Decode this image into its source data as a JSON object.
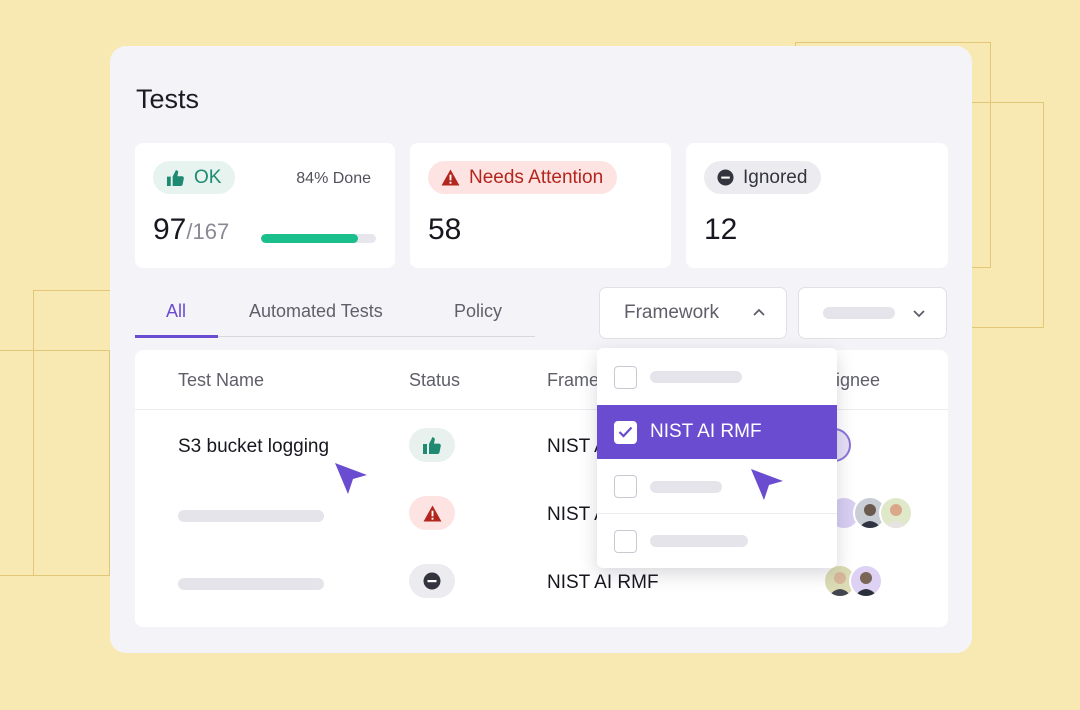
{
  "page": {
    "title": "Tests"
  },
  "stats": [
    {
      "pill_label": "OK",
      "icon": "thumbs-up-icon",
      "value": "97",
      "total": "/167",
      "done_label": "84% Done",
      "progress": 0.84,
      "color": "#1f8a72"
    },
    {
      "pill_label": "Needs Attention",
      "icon": "warning-triangle-icon",
      "value": "58",
      "color": "#b3261e"
    },
    {
      "pill_label": "Ignored",
      "icon": "minus-circle-icon",
      "value": "12",
      "color": "#34343f"
    }
  ],
  "tabs": [
    {
      "label": "All",
      "active": true
    },
    {
      "label": "Automated Tests",
      "active": false
    },
    {
      "label": "Policy",
      "active": false
    }
  ],
  "filters": {
    "framework_label": "Framework",
    "framework_icon": "chevron-up-icon",
    "second_icon": "chevron-down-icon"
  },
  "table": {
    "columns": [
      "Test Name",
      "Status",
      "Frame",
      "signee"
    ],
    "rows": [
      {
        "name": "S3 bucket logging",
        "status": "ok",
        "framework": "NIST A"
      },
      {
        "name": "",
        "status": "needs-attention",
        "framework": "NIST A"
      },
      {
        "name": "",
        "status": "ignored",
        "framework": "NIST AI RMF"
      }
    ]
  },
  "dropdown": {
    "items": [
      {
        "label": "",
        "checked": false
      },
      {
        "label": "NIST AI RMF",
        "checked": true
      },
      {
        "label": "",
        "checked": false
      },
      {
        "label": "",
        "checked": false
      }
    ]
  },
  "colors": {
    "accent": "#6a4cd0",
    "ok": "#1bbf8c",
    "warn": "#b3261e",
    "background": "#f8e9b3"
  }
}
